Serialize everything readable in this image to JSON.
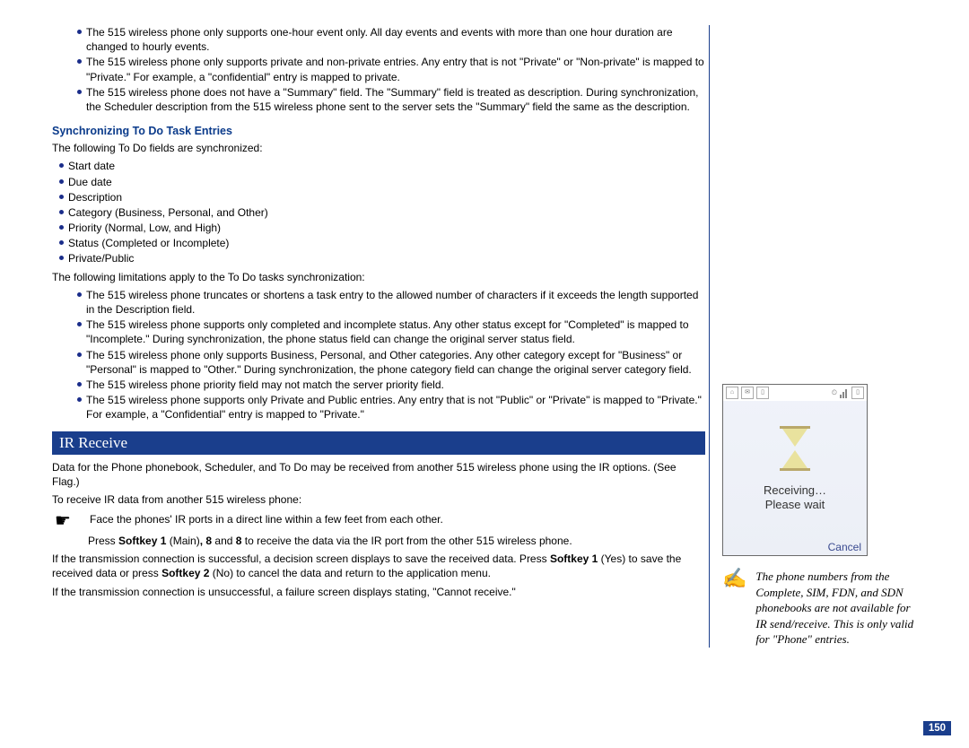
{
  "top_bullets": [
    "The 515 wireless phone only supports one-hour event only. All day events and events with more than one hour duration are changed to hourly events.",
    "The 515 wireless phone only supports private and non-private entries. Any entry that is not \"Private\" or \"Non-private\" is mapped to \"Private.\" For example, a \"confidential\" entry is mapped to private.",
    "The 515 wireless phone does not have a \"Summary\" field. The \"Summary\" field is treated as description. During synchronization, the Scheduler description from the 515 wireless phone sent to the server sets the \"Summary\" field the same as the description."
  ],
  "section_a": {
    "heading": "Synchronizing To Do Task Entries",
    "intro": "The following To Do fields are synchronized:",
    "fields": [
      "Start date",
      "Due date",
      "Description",
      "Category (Business, Personal, and Other)",
      "Priority (Normal, Low, and High)",
      "Status (Completed or Incomplete)",
      "Private/Public"
    ],
    "limit_intro": "The following limitations apply to the To Do tasks synchronization:",
    "limits": [
      "The 515 wireless phone truncates or shortens a task entry to the allowed number of characters if it exceeds the length supported in the Description field.",
      "The 515 wireless phone supports only completed and incomplete status. Any other status except for \"Completed\" is mapped to \"Incomplete.\" During synchronization, the phone status field can change the original server status field.",
      "The 515 wireless phone only supports Business, Personal, and Other categories. Any other category except for \"Business\" or \"Personal\" is mapped to \"Other.\" During synchronization, the phone category field can change the original server category field.",
      "The 515 wireless phone priority field may not match the server priority field.",
      "The 515 wireless phone supports only Private and Public entries. Any entry that is not \"Public\" or \"Private\" is mapped to \"Private.\" For example, a \"Confidential\" entry is mapped to \"Private.\""
    ]
  },
  "ir": {
    "heading": "IR Receive",
    "para1": "Data for the Phone phonebook, Scheduler, and To Do may be received from another 515 wireless phone using the IR options. (See Flag.)",
    "para2": "To receive IR data from another 515 wireless phone:",
    "step1": "Face the phones' IR ports in a direct line within a few feet from each other.",
    "step2_pre": "Press ",
    "step2_sk1": "Softkey 1",
    "step2_mid1": " (Main)",
    "step2_bold8": ", 8",
    "step2_mid2": " and ",
    "step2_bold8b": "8",
    "step2_mid3": " to receive the data via the IR port from the other 515 wireless phone.",
    "para3_pre": "If the transmission connection is successful, a decision screen displays to save the received data. Press ",
    "para3_sk1": "Softkey 1",
    "para3_mid": " (Yes) to save the received data or press ",
    "para3_sk2": "Softkey 2",
    "para3_end": " (No) to cancel the data and return to the application menu.",
    "para4": "If the transmission connection is unsuccessful, a failure screen displays stating, \"Cannot receive.\""
  },
  "phone": {
    "line1": "Receiving…",
    "line2": "Please wait",
    "softkey": "Cancel"
  },
  "note": "The phone numbers from the Complete, SIM, FDN, and SDN phonebooks are not available for IR send/receive. This is only valid for \"Phone\" entries.",
  "page_num": "150"
}
